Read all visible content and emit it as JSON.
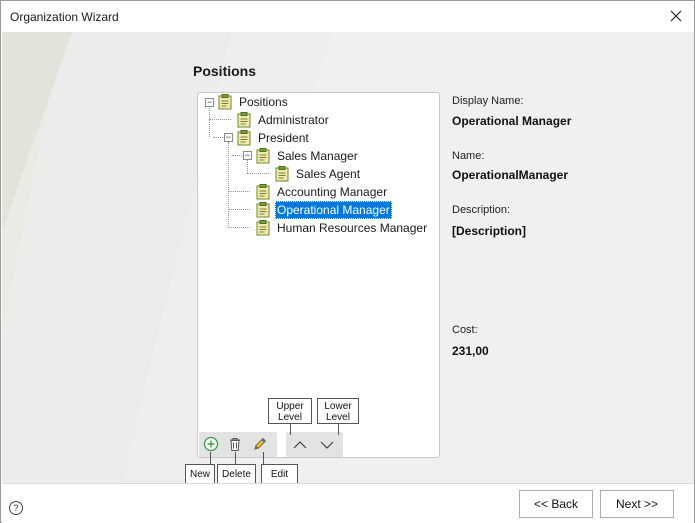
{
  "window": {
    "title": "Organization Wizard"
  },
  "page": {
    "heading": "Positions"
  },
  "tree": {
    "root": "Positions",
    "items": [
      "Administrator",
      "President",
      "Sales Manager",
      "Sales Agent",
      "Accounting Manager",
      "Operational Manager",
      "Human Resources Manager"
    ],
    "selected": "Operational Manager"
  },
  "toolbar": {
    "new_label": "New",
    "delete_label": "Delete",
    "edit_label": "Edit",
    "upper_label_1": "Upper",
    "upper_label_2": "Level",
    "lower_label_1": "Lower",
    "lower_label_2": "Level"
  },
  "details": {
    "display_name_label": "Display Name:",
    "display_name_value": "Operational Manager",
    "name_label": "Name:",
    "name_value": "OperationalManager",
    "description_label": "Description:",
    "description_value": "[Description]",
    "cost_label": "Cost:",
    "cost_value": "231,00"
  },
  "footer": {
    "help": "?",
    "back_label": "<< Back",
    "next_label": "Next >>"
  },
  "colors": {
    "selection": "#0078d7",
    "add": "#3b9a3b",
    "edit": "#c48a1a"
  },
  "icons": [
    "close-icon",
    "clipboard-icon",
    "add-icon",
    "trash-icon",
    "pencil-icon",
    "chevron-up-icon",
    "chevron-down-icon",
    "help-icon"
  ]
}
